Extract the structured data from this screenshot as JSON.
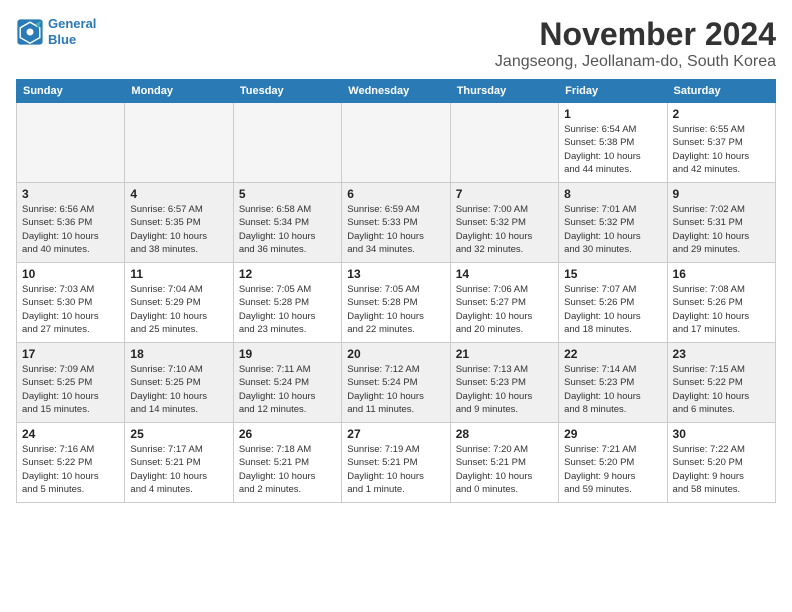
{
  "logo": {
    "line1": "General",
    "line2": "Blue"
  },
  "title": "November 2024",
  "subtitle": "Jangseong, Jeollanam-do, South Korea",
  "weekdays": [
    "Sunday",
    "Monday",
    "Tuesday",
    "Wednesday",
    "Thursday",
    "Friday",
    "Saturday"
  ],
  "weeks": [
    [
      {
        "day": "",
        "detail": ""
      },
      {
        "day": "",
        "detail": ""
      },
      {
        "day": "",
        "detail": ""
      },
      {
        "day": "",
        "detail": ""
      },
      {
        "day": "",
        "detail": ""
      },
      {
        "day": "1",
        "detail": "Sunrise: 6:54 AM\nSunset: 5:38 PM\nDaylight: 10 hours\nand 44 minutes."
      },
      {
        "day": "2",
        "detail": "Sunrise: 6:55 AM\nSunset: 5:37 PM\nDaylight: 10 hours\nand 42 minutes."
      }
    ],
    [
      {
        "day": "3",
        "detail": "Sunrise: 6:56 AM\nSunset: 5:36 PM\nDaylight: 10 hours\nand 40 minutes."
      },
      {
        "day": "4",
        "detail": "Sunrise: 6:57 AM\nSunset: 5:35 PM\nDaylight: 10 hours\nand 38 minutes."
      },
      {
        "day": "5",
        "detail": "Sunrise: 6:58 AM\nSunset: 5:34 PM\nDaylight: 10 hours\nand 36 minutes."
      },
      {
        "day": "6",
        "detail": "Sunrise: 6:59 AM\nSunset: 5:33 PM\nDaylight: 10 hours\nand 34 minutes."
      },
      {
        "day": "7",
        "detail": "Sunrise: 7:00 AM\nSunset: 5:32 PM\nDaylight: 10 hours\nand 32 minutes."
      },
      {
        "day": "8",
        "detail": "Sunrise: 7:01 AM\nSunset: 5:32 PM\nDaylight: 10 hours\nand 30 minutes."
      },
      {
        "day": "9",
        "detail": "Sunrise: 7:02 AM\nSunset: 5:31 PM\nDaylight: 10 hours\nand 29 minutes."
      }
    ],
    [
      {
        "day": "10",
        "detail": "Sunrise: 7:03 AM\nSunset: 5:30 PM\nDaylight: 10 hours\nand 27 minutes."
      },
      {
        "day": "11",
        "detail": "Sunrise: 7:04 AM\nSunset: 5:29 PM\nDaylight: 10 hours\nand 25 minutes."
      },
      {
        "day": "12",
        "detail": "Sunrise: 7:05 AM\nSunset: 5:28 PM\nDaylight: 10 hours\nand 23 minutes."
      },
      {
        "day": "13",
        "detail": "Sunrise: 7:05 AM\nSunset: 5:28 PM\nDaylight: 10 hours\nand 22 minutes."
      },
      {
        "day": "14",
        "detail": "Sunrise: 7:06 AM\nSunset: 5:27 PM\nDaylight: 10 hours\nand 20 minutes."
      },
      {
        "day": "15",
        "detail": "Sunrise: 7:07 AM\nSunset: 5:26 PM\nDaylight: 10 hours\nand 18 minutes."
      },
      {
        "day": "16",
        "detail": "Sunrise: 7:08 AM\nSunset: 5:26 PM\nDaylight: 10 hours\nand 17 minutes."
      }
    ],
    [
      {
        "day": "17",
        "detail": "Sunrise: 7:09 AM\nSunset: 5:25 PM\nDaylight: 10 hours\nand 15 minutes."
      },
      {
        "day": "18",
        "detail": "Sunrise: 7:10 AM\nSunset: 5:25 PM\nDaylight: 10 hours\nand 14 minutes."
      },
      {
        "day": "19",
        "detail": "Sunrise: 7:11 AM\nSunset: 5:24 PM\nDaylight: 10 hours\nand 12 minutes."
      },
      {
        "day": "20",
        "detail": "Sunrise: 7:12 AM\nSunset: 5:24 PM\nDaylight: 10 hours\nand 11 minutes."
      },
      {
        "day": "21",
        "detail": "Sunrise: 7:13 AM\nSunset: 5:23 PM\nDaylight: 10 hours\nand 9 minutes."
      },
      {
        "day": "22",
        "detail": "Sunrise: 7:14 AM\nSunset: 5:23 PM\nDaylight: 10 hours\nand 8 minutes."
      },
      {
        "day": "23",
        "detail": "Sunrise: 7:15 AM\nSunset: 5:22 PM\nDaylight: 10 hours\nand 6 minutes."
      }
    ],
    [
      {
        "day": "24",
        "detail": "Sunrise: 7:16 AM\nSunset: 5:22 PM\nDaylight: 10 hours\nand 5 minutes."
      },
      {
        "day": "25",
        "detail": "Sunrise: 7:17 AM\nSunset: 5:21 PM\nDaylight: 10 hours\nand 4 minutes."
      },
      {
        "day": "26",
        "detail": "Sunrise: 7:18 AM\nSunset: 5:21 PM\nDaylight: 10 hours\nand 2 minutes."
      },
      {
        "day": "27",
        "detail": "Sunrise: 7:19 AM\nSunset: 5:21 PM\nDaylight: 10 hours\nand 1 minute."
      },
      {
        "day": "28",
        "detail": "Sunrise: 7:20 AM\nSunset: 5:21 PM\nDaylight: 10 hours\nand 0 minutes."
      },
      {
        "day": "29",
        "detail": "Sunrise: 7:21 AM\nSunset: 5:20 PM\nDaylight: 9 hours\nand 59 minutes."
      },
      {
        "day": "30",
        "detail": "Sunrise: 7:22 AM\nSunset: 5:20 PM\nDaylight: 9 hours\nand 58 minutes."
      }
    ]
  ]
}
